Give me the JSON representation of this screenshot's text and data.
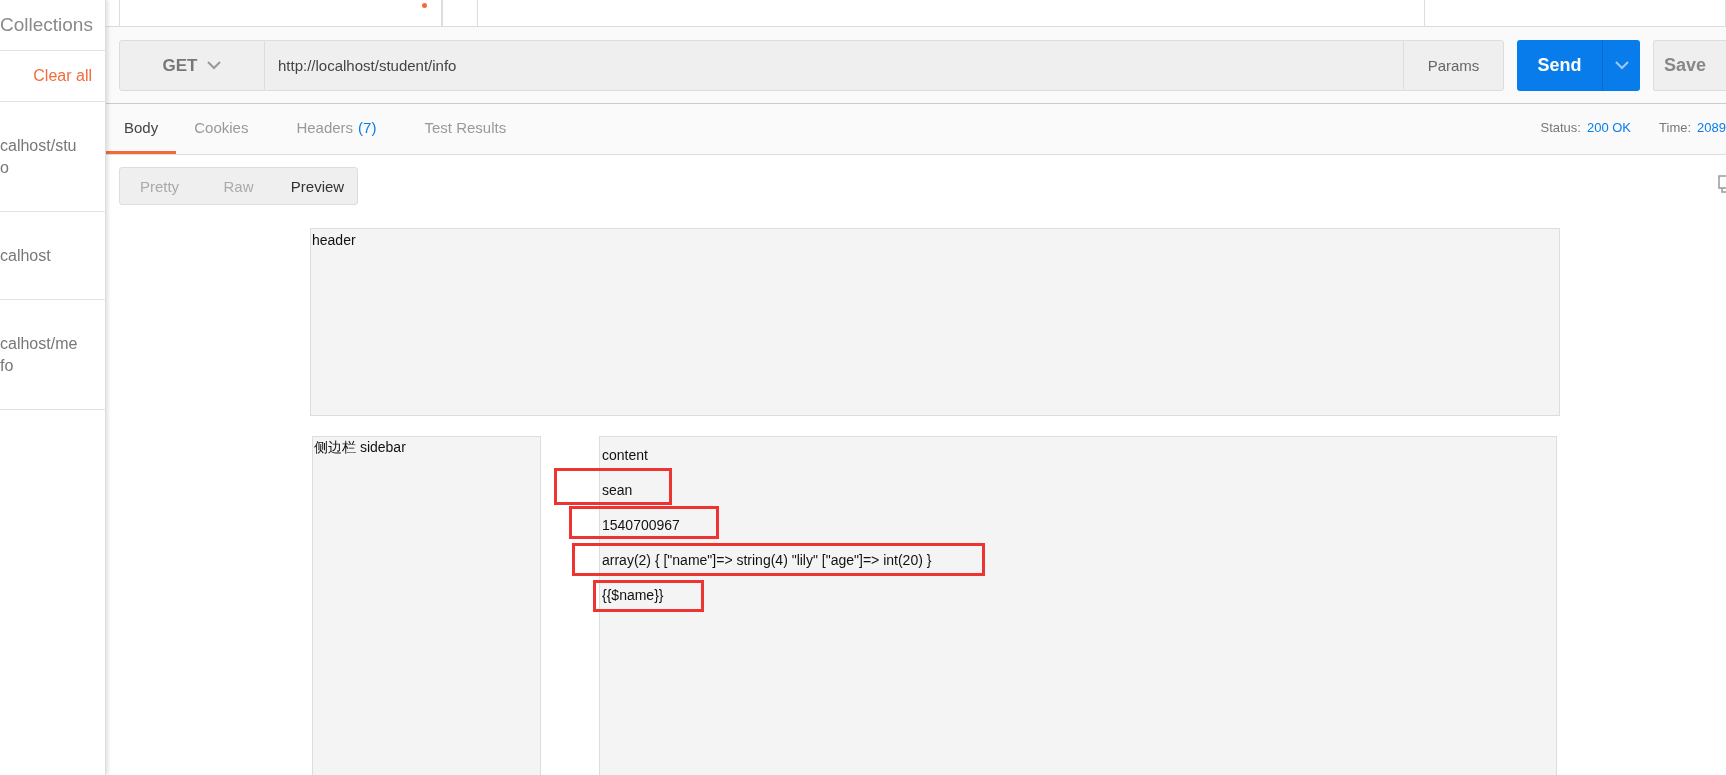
{
  "sidebar": {
    "title": "Collections",
    "clear_all": "Clear all",
    "history": [
      {
        "lines": [
          "calhost/stu",
          "o"
        ]
      },
      {
        "lines": [
          "calhost"
        ]
      },
      {
        "lines": [
          "calhost/me",
          "fo"
        ]
      }
    ]
  },
  "request": {
    "method": "GET",
    "url": "http://localhost/student/info",
    "params": "Params",
    "send": "Send",
    "save": "Save"
  },
  "response_tabs": [
    {
      "label": "Body",
      "selected": true
    },
    {
      "label": "Cookies",
      "selected": false
    },
    {
      "label": "Headers",
      "count": "(7)",
      "selected": false
    },
    {
      "label": "Test Results",
      "selected": false
    }
  ],
  "status": {
    "status_label": "Status:",
    "status_value": "200 OK",
    "time_label": "Time:",
    "time_value": "2089"
  },
  "format_buttons": [
    {
      "label": "Pretty",
      "selected": false
    },
    {
      "label": "Raw",
      "selected": false
    },
    {
      "label": "Preview",
      "selected": true
    }
  ],
  "preview": {
    "header": "header",
    "sidebar": "侧边栏 sidebar",
    "content_lines": [
      {
        "text": "content",
        "highlighted": false
      },
      {
        "text": "sean",
        "highlighted": true
      },
      {
        "text": "1540700967",
        "highlighted": true
      },
      {
        "text": "array(2) { [\"name\"]=> string(4) \"lily\" [\"age\"]=> int(20) }",
        "highlighted": true
      },
      {
        "text": "{{$name}}",
        "highlighted": true
      }
    ]
  }
}
